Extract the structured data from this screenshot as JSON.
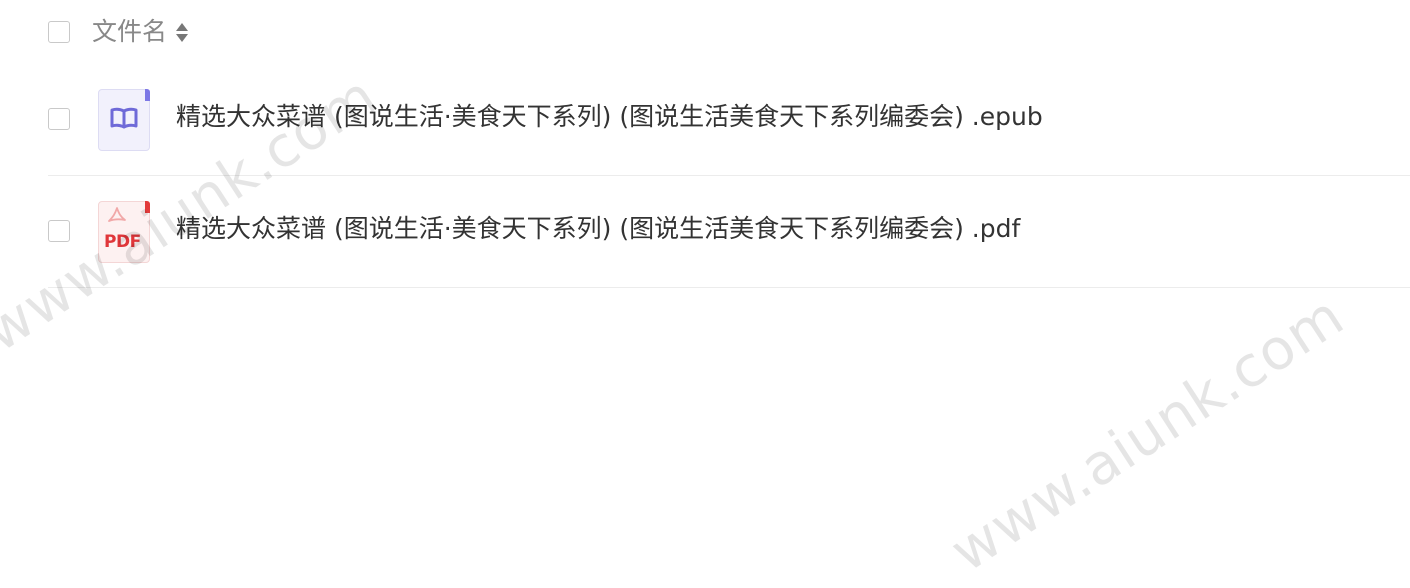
{
  "header": {
    "column_title": "文件名"
  },
  "files": [
    {
      "name": "精选大众菜谱 (图说生活·美食天下系列) (图说生活美食天下系列编委会) .epub",
      "type": "epub",
      "icon": "epub-book-icon",
      "accent": "#7d78e6"
    },
    {
      "name": "精选大众菜谱 (图说生活·美食天下系列) (图说生活美食天下系列编委会) .pdf",
      "type": "pdf",
      "icon": "pdf-file-icon",
      "icon_text": "PDF",
      "accent": "#e0363a"
    }
  ],
  "watermark": {
    "text": "www.aiunk.com"
  }
}
